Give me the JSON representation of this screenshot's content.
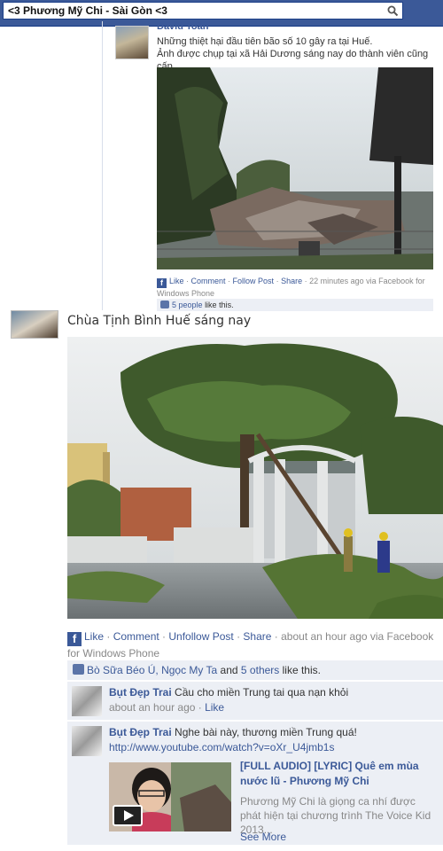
{
  "search": {
    "value": "<3 Phương Mỹ Chi - Sài Gòn <3"
  },
  "post1": {
    "author": "David Toàn",
    "text_line1": "Những thiệt hại đầu tiên bão số 10 gây ra tại Huế.",
    "text_line2": "Ảnh được chụp tại xã Hải Dương sáng nay do thành viên cũng cấp.",
    "actions": {
      "like": "Like",
      "comment": "Comment",
      "follow": "Follow Post",
      "share": "Share",
      "time": "22 minutes ago via Facebook for Windows Phone"
    },
    "likes": {
      "count_link": "5 people",
      "suffix": "like this."
    }
  },
  "post2": {
    "title": "Chùa Tịnh Bình Huế sáng nay",
    "actions": {
      "like": "Like",
      "comment": "Comment",
      "unfollow": "Unfollow Post",
      "share": "Share",
      "time": "about an hour ago via Facebook for Windows Phone"
    },
    "likes": {
      "names": "Bò Sữa Béo Ú, Ngọc My Ta",
      "and": " and ",
      "others": "5 others",
      "suffix": " like this."
    },
    "comments": [
      {
        "name": "Bụt Đẹp Trai",
        "text": " Cầu cho miền Trung tai qua nạn khỏi",
        "time": "about an hour ago",
        "like": "Like"
      },
      {
        "name": "Bụt Đẹp Trai",
        "text": " Nghe bài này, thương miền Trung quá!",
        "url": "http://www.youtube.com/watch?v=oXr_U4jmb1s",
        "card": {
          "title": "[FULL AUDIO] [LYRIC] Quê em mùa nước lũ - Phương Mỹ Chi",
          "desc": "Phương Mỹ Chi là giọng ca nhí được phát hiện tại chương trình The Voice Kid 2013...",
          "more": "See More"
        }
      }
    ]
  },
  "colors": {
    "brand": "#3b5998",
    "likes_bg": "#eceff5",
    "meta": "#888888"
  },
  "icons": [
    "search-icon",
    "facebook-icon",
    "thumbs-up-icon",
    "play-icon"
  ]
}
